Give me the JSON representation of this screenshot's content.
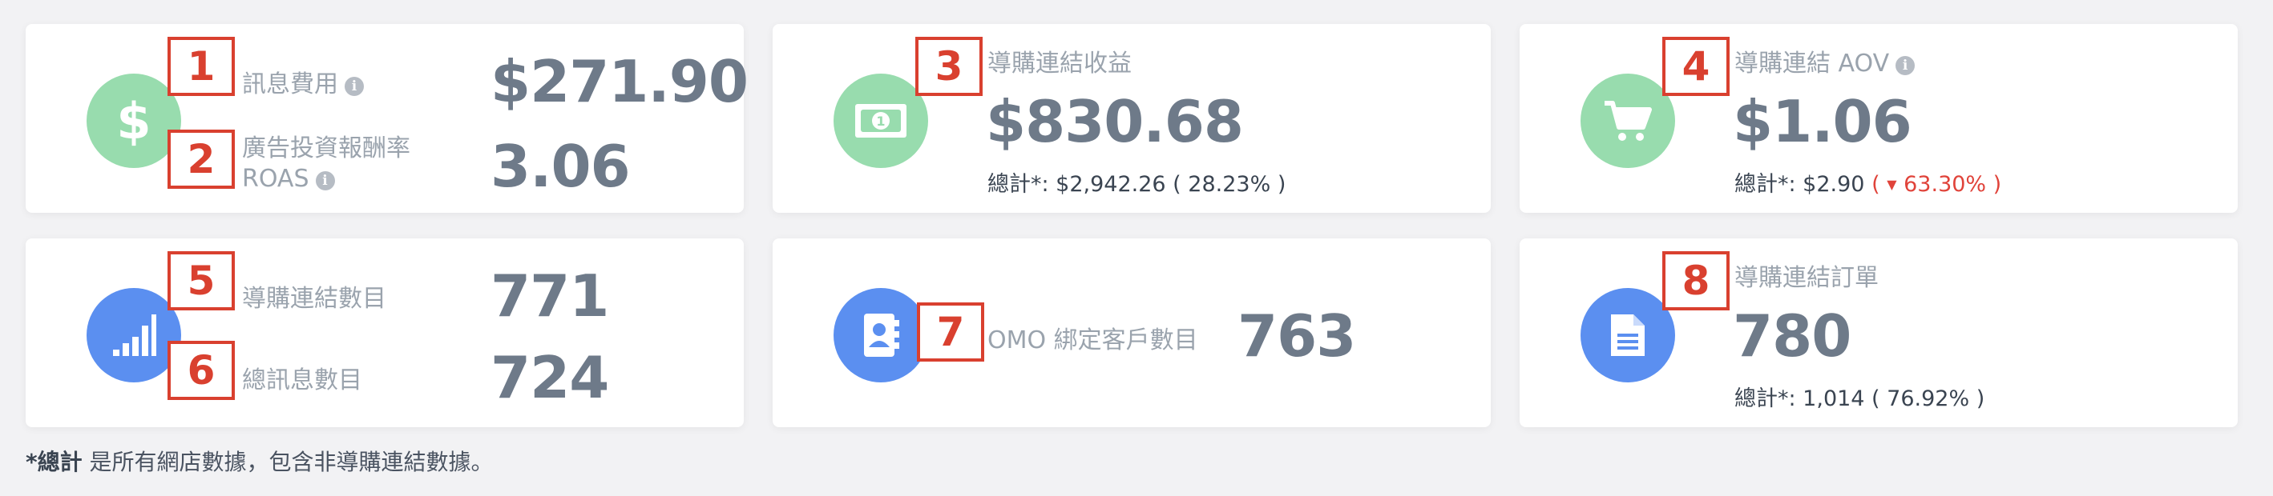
{
  "cards": {
    "message_cost": {
      "label": "訊息費用",
      "value": "$271.90"
    },
    "roas": {
      "label_line1": "廣告投資報酬率",
      "label_line2": "ROAS",
      "value": "3.06"
    },
    "link_revenue": {
      "label": "導購連結收益",
      "value": "$830.68",
      "total_prefix": "總計*: $2,942.26 ( 28.23% )"
    },
    "link_aov": {
      "label": "導購連結 AOV",
      "value": "$1.06",
      "total_prefix": "總計*: $2.90",
      "change": "63.30% )",
      "change_open": "(",
      "change_direction": "down"
    },
    "link_count": {
      "label": "導購連結數目",
      "value": "771"
    },
    "message_count": {
      "label": "總訊息數目",
      "value": "724"
    },
    "omo_customers": {
      "label": "OMO 綁定客戶數目",
      "value": "763"
    },
    "link_orders": {
      "label": "導購連結訂單",
      "value": "780",
      "total_prefix": "總計*: 1,014 ( 76.92% )"
    }
  },
  "markers": [
    "1",
    "2",
    "3",
    "4",
    "5",
    "6",
    "7",
    "8"
  ],
  "footnote": {
    "bold": "*總計",
    "text": " 是所有網店數據，包含非導購連結數據。"
  },
  "icons": {
    "dollar": "dollar-icon",
    "money": "money-bill-icon",
    "cart": "shopping-cart-icon",
    "signal": "signal-bars-icon",
    "contact": "address-book-icon",
    "document": "file-document-icon",
    "info": "info-icon"
  },
  "colors": {
    "green_icon": "#98dcae",
    "blue_icon": "#5b8ff0",
    "value_text": "#6e7a89",
    "label_text": "#9aa3ad",
    "negative": "#e0433a",
    "marker": "#d9402f"
  }
}
